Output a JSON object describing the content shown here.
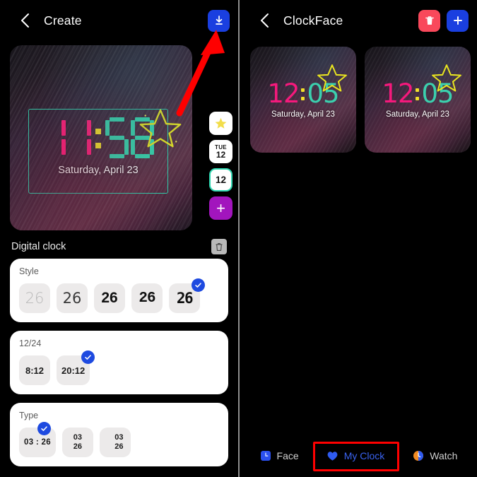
{
  "left": {
    "topbar": {
      "back_icon": "chevron-left-icon",
      "title": "Create",
      "download_icon": "download-icon"
    },
    "preview": {
      "time_hours": "11",
      "time_minutes": "58",
      "colon": ":",
      "date": "Saturday, April 23",
      "sticker": "star-sticker",
      "hours_color": "#ff1f7a",
      "minutes_color": "#35d6ad",
      "colon_color": "#f5e528",
      "selection_color": "#2fd0ac"
    },
    "side_tools": [
      {
        "name": "sticker-tool",
        "icon": "star-icon",
        "label": "",
        "selected": false
      },
      {
        "name": "date-tool",
        "line1": "TUE",
        "line2": "12",
        "selected": false
      },
      {
        "name": "clock-tool",
        "label": "12",
        "selected": true
      },
      {
        "name": "add-tool",
        "label": "+",
        "selected": false
      }
    ],
    "section": {
      "title": "Digital clock",
      "delete_icon": "trash-icon"
    },
    "style_card": {
      "label": "Style",
      "options": [
        {
          "text": "26",
          "selected": false
        },
        {
          "text": "26",
          "selected": false
        },
        {
          "text": "26",
          "selected": false
        },
        {
          "text": "26",
          "selected": false
        },
        {
          "text": "26",
          "selected": true
        }
      ]
    },
    "hour_format_card": {
      "label": "12/24",
      "options": [
        {
          "text": "8:12",
          "selected": false
        },
        {
          "text": "20:12",
          "selected": true
        }
      ]
    },
    "type_card": {
      "label": "Type",
      "options": [
        {
          "text": "03 : 26",
          "line1": "03",
          "line2": "26",
          "selected": true
        },
        {
          "text": "03 26",
          "line1": "03",
          "line2": "26",
          "selected": false
        },
        {
          "text": "03 26",
          "line1": "03",
          "line2": "26",
          "selected": false
        }
      ]
    },
    "annotation": {
      "arrow": "red-arrow-pointing-to-download-button"
    }
  },
  "right": {
    "topbar": {
      "back_icon": "chevron-left-icon",
      "title": "ClockFace",
      "delete_icon": "trash-icon",
      "add_icon": "plus-icon"
    },
    "faces": [
      {
        "hours": "12",
        "minutes": "05",
        "date": "Saturday, April 23",
        "sticker": "star-sticker"
      },
      {
        "hours": "12",
        "minutes": "05",
        "date": "Saturday, April 23",
        "sticker": "star-sticker"
      }
    ],
    "bottom_nav": {
      "items": [
        {
          "label": "Face",
          "icon": "clock-square-icon",
          "active": false
        },
        {
          "label": "My Clock",
          "icon": "heart-icon",
          "active": true
        },
        {
          "label": "Watch",
          "icon": "watch-circle-icon",
          "active": false
        }
      ],
      "highlight": "red-box-around-my-clock"
    }
  },
  "colors": {
    "accent_blue": "#1a3fe0",
    "accent_red": "#f9485b",
    "accent_purple": "#a215bd",
    "accent_teal": "#2fd6b0",
    "annotation_red": "#ff0000"
  }
}
